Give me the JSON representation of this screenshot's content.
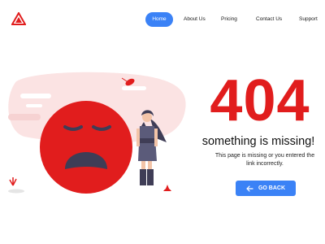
{
  "nav": {
    "items": [
      {
        "label": "Home",
        "active": true
      },
      {
        "label": "About Us",
        "active": false
      },
      {
        "label": "Pricing",
        "active": false
      },
      {
        "label": "Contact Us",
        "active": false
      },
      {
        "label": "Support",
        "active": false
      }
    ]
  },
  "error": {
    "code": "404",
    "headline": "something is missing!",
    "message": "This page is missing or you entered the link incorrectly.",
    "button_label": "GO BACK",
    "button_icon": "arrow-left-icon"
  },
  "colors": {
    "accent": "#3b82f6",
    "error_red": "#e11d1d",
    "illustration_pink": "#fbe3e3",
    "figure_dark": "#3f3d56"
  }
}
